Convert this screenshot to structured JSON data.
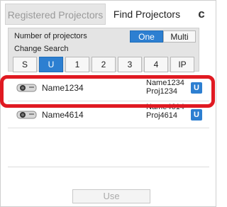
{
  "tabs": {
    "registered": "Registered Projectors",
    "find": "Find Projectors",
    "refresh_glyph": "c"
  },
  "settings": {
    "number_label": "Number of projectors",
    "mode_one": "One",
    "mode_multi": "Multi",
    "mode_selected": "One",
    "change_search_label": "Change Search",
    "search_buttons": [
      "S",
      "U",
      "1",
      "2",
      "3",
      "4",
      "IP"
    ],
    "search_selected": "U"
  },
  "projectors": [
    {
      "name": "Name1234",
      "detail_name": "Name1234",
      "detail_proj": "Proj1234",
      "badge": "U"
    },
    {
      "name": "Name4614",
      "detail_name": "Name4614",
      "detail_proj": "Proj4614",
      "badge": "U"
    }
  ],
  "actions": {
    "use": "Use"
  },
  "colors": {
    "accent": "#2d7fd1",
    "highlight": "#e01a22"
  }
}
